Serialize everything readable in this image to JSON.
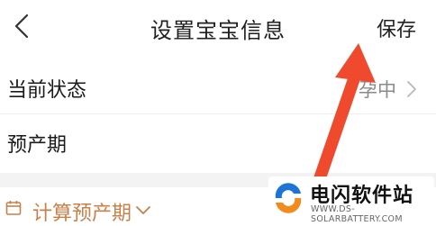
{
  "header": {
    "title": "设置宝宝信息",
    "save_label": "保存"
  },
  "rows": [
    {
      "label": "当前状态",
      "value": "孕中"
    },
    {
      "label": "预产期",
      "value": ""
    }
  ],
  "calculate": {
    "label": "计算预产期"
  },
  "watermark": {
    "name": "电闪软件站",
    "url": "WWW.DS-SOLARBATTERY.COM"
  },
  "colors": {
    "accent": "#c8804a",
    "annotation_arrow": "#f04a2e",
    "divider": "#ededed"
  },
  "icons": {
    "back": "chevron-left-icon",
    "row_more": "chevron-right-icon",
    "calculate": "calendar-icon",
    "expand": "chevron-down-icon"
  }
}
